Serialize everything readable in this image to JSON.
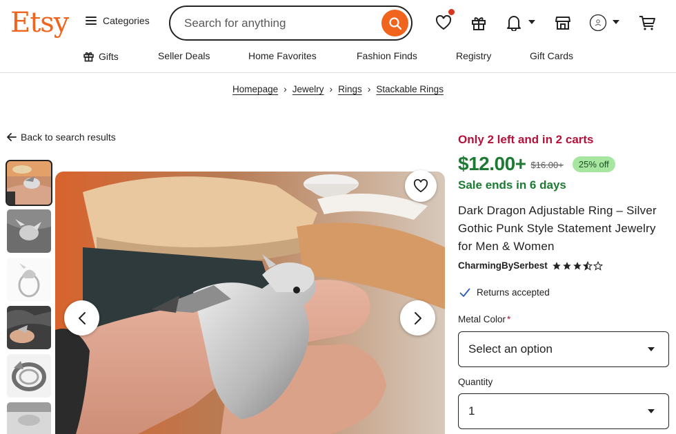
{
  "header": {
    "logo": "Etsy",
    "categories_label": "Categories",
    "search_placeholder": "Search for anything",
    "icons": [
      "heart-icon",
      "gift-icon",
      "bell-icon",
      "store-icon",
      "avatar",
      "cart-icon"
    ]
  },
  "subnav": {
    "items": [
      {
        "label": "Gifts",
        "icon": "gift-icon"
      },
      {
        "label": "Seller Deals"
      },
      {
        "label": "Home Favorites"
      },
      {
        "label": "Fashion Finds"
      },
      {
        "label": "Registry"
      },
      {
        "label": "Gift Cards"
      }
    ]
  },
  "breadcrumb": {
    "items": [
      "Homepage",
      "Jewelry",
      "Rings",
      "Stackable Rings"
    ]
  },
  "back_link": "Back to search results",
  "listing": {
    "stock_notice": "Only 2 left and in 2 carts",
    "price": "$12.00+",
    "original_price": "$16.00+",
    "discount": "25% off",
    "sale_ends": "Sale ends in 6 days",
    "title": "Dark Dragon Adjustable Ring – Silver Gothic Punk Style Statement Jewelry for Men & Women",
    "shop_name": "CharmingBySerbest",
    "rating": 3.5,
    "returns": "Returns accepted",
    "metal_color_label": "Metal Color",
    "required_marker": "*",
    "metal_color_value": "Select an option",
    "quantity_label": "Quantity",
    "quantity_value": "1"
  },
  "colors": {
    "brand": "#f1641e",
    "sale_green": "#1d7a33",
    "stock_red": "#b3123b",
    "discount_bg": "#a7e6a0"
  }
}
